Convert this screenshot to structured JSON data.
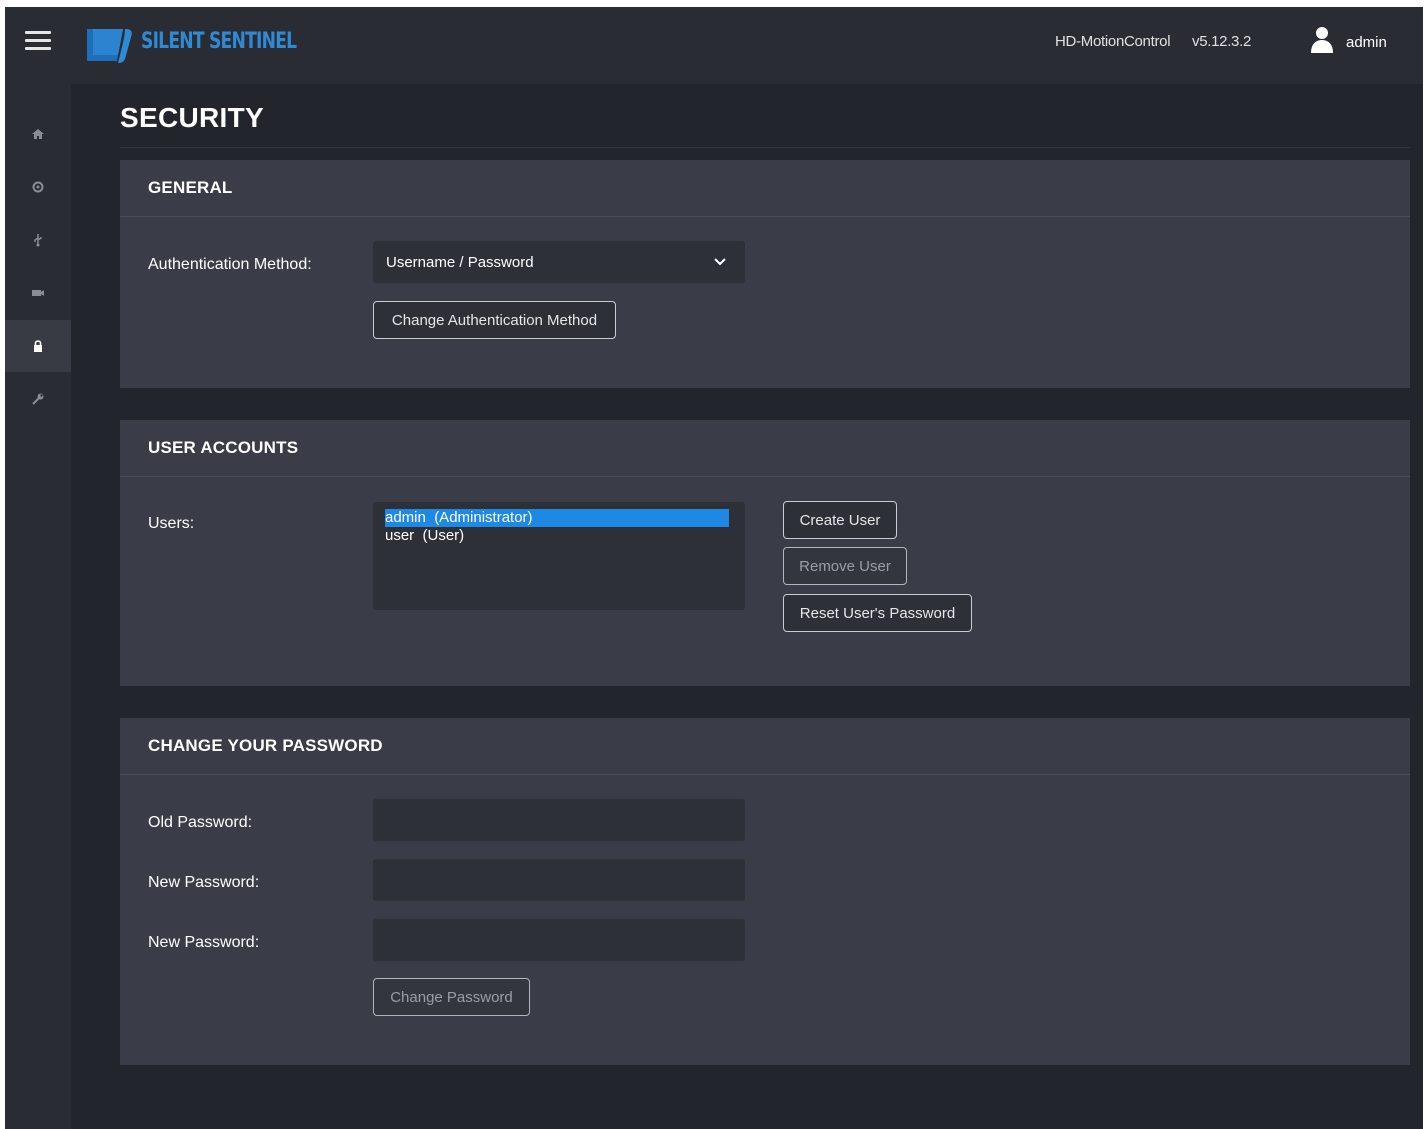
{
  "header": {
    "logo_text": "SILENT SENTINEL",
    "app_name": "HD-MotionControl",
    "version": "v5.12.3.2",
    "user": "admin"
  },
  "sidebar": {
    "items": [
      {
        "icon": "home-icon"
      },
      {
        "icon": "gear-icon"
      },
      {
        "icon": "usb-icon"
      },
      {
        "icon": "camera-icon"
      },
      {
        "icon": "lock-icon",
        "active": true
      },
      {
        "icon": "wrench-icon"
      }
    ]
  },
  "page": {
    "title": "SECURITY"
  },
  "general": {
    "header": "GENERAL",
    "auth_label": "Authentication Method:",
    "auth_value": "Username / Password",
    "change_auth_button": "Change Authentication Method"
  },
  "accounts": {
    "header": "USER ACCOUNTS",
    "users_label": "Users:",
    "users": [
      {
        "label": "admin  (Administrator)",
        "selected": true
      },
      {
        "label": "user  (User)",
        "selected": false
      }
    ],
    "create_button": "Create User",
    "remove_button": "Remove User",
    "reset_button": "Reset User's Password"
  },
  "password": {
    "header": "CHANGE YOUR PASSWORD",
    "old_label": "Old Password:",
    "new_label": "New Password:",
    "confirm_label": "New Password:",
    "old_value": "",
    "new_value": "",
    "confirm_value": "",
    "change_button": "Change Password"
  },
  "colors": {
    "accent": "#1e88e5",
    "background": "#23252c",
    "panel": "#3a3d47",
    "logo": "#2f8ad6"
  }
}
